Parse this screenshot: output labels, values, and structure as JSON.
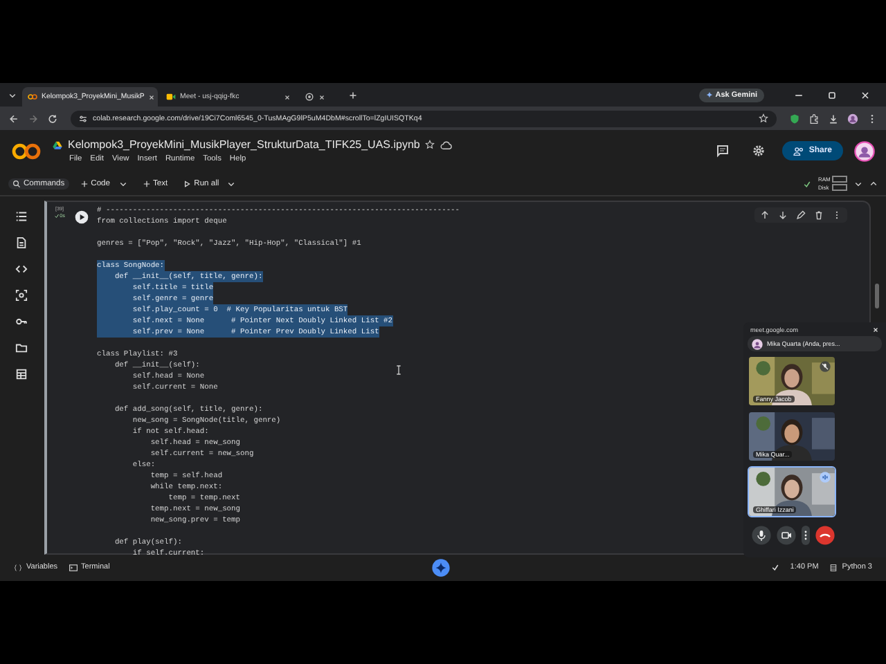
{
  "browser": {
    "tabs": [
      {
        "label": "Kelompok3_ProyekMini_MusikP",
        "selected": true
      },
      {
        "label": "Meet - usj-qqig-fkc",
        "selected": false
      },
      {
        "selected": false
      }
    ],
    "gemini_button": "Ask Gemini",
    "address": "colab.research.google.com/drive/19Ci7Coml6545_0-TusMAgG9lP5uM4DbM#scrollTo=lZgIUISQTKq4"
  },
  "notebook": {
    "title": "Kelompok3_ProyekMini_MusikPlayer_StrukturData_TIFK25_UAS.ipynb",
    "menu": [
      "File",
      "Edit",
      "View",
      "Insert",
      "Runtime",
      "Tools",
      "Help"
    ],
    "share_button": "Share",
    "toolbar": [
      "Commands",
      "Code",
      "Text",
      "Run all"
    ],
    "resources": [
      "RAM",
      "Disk"
    ]
  },
  "cell": {
    "execution_count": "[39]",
    "run_time": "0s",
    "blocks": [
      [
        {
          "text": "# -------------------------------------------------------------------------------",
          "selected": false
        },
        {
          "text": "from collections import deque",
          "selected": false
        }
      ],
      [
        {
          "text": "genres = [\"Pop\", \"Rock\", \"Jazz\", \"Hip-Hop\", \"Classical\"] #1",
          "selected": false
        }
      ],
      [
        {
          "text": "class SongNode:",
          "selected": true
        },
        {
          "text": "    def __init__(self, title, genre):",
          "selected": true
        },
        {
          "text": "        self.title = title",
          "selected": true
        },
        {
          "text": "        self.genre = genre",
          "selected": true
        },
        {
          "text": "        self.play_count = 0  # Key Popularitas untuk BST",
          "selected": true
        },
        {
          "text": "        self.next = None      # Pointer Next Doubly Linked List #2",
          "selected": true
        },
        {
          "text": "        self.prev = None      # Pointer Prev Doubly Linked List",
          "selected": true
        }
      ],
      [
        {
          "text": "class Playlist: #3",
          "selected": false
        },
        {
          "text": "    def __init__(self):",
          "selected": false
        },
        {
          "text": "        self.head = None",
          "selected": false
        },
        {
          "text": "        self.current = None",
          "selected": false
        }
      ],
      [
        {
          "text": "    def add_song(self, title, genre):",
          "selected": false
        },
        {
          "text": "        new_song = SongNode(title, genre)",
          "selected": false
        },
        {
          "text": "        if not self.head:",
          "selected": false
        },
        {
          "text": "            self.head = new_song",
          "selected": false
        },
        {
          "text": "            self.current = new_song",
          "selected": false
        },
        {
          "text": "        else:",
          "selected": false
        },
        {
          "text": "            temp = self.head",
          "selected": false
        },
        {
          "text": "            while temp.next:",
          "selected": false
        },
        {
          "text": "                temp = temp.next",
          "selected": false
        },
        {
          "text": "            temp.next = new_song",
          "selected": false
        },
        {
          "text": "            new_song.prev = temp",
          "selected": false
        }
      ],
      [
        {
          "text": "    def play(self):",
          "selected": false
        },
        {
          "text": "        if self.current:",
          "selected": false
        }
      ]
    ]
  },
  "status_bar": {
    "items": [
      "Variables",
      "Terminal"
    ],
    "time": "1:40 PM",
    "runtime": "Python 3"
  },
  "meet": {
    "site": "meet.google.com",
    "presenter": "Mika Quarta (Anda, pres...",
    "participants": [
      {
        "name": "Fanny Jacob",
        "muted": true,
        "speaking": false
      },
      {
        "name": "Mika Quar...",
        "muted": false,
        "speaking": false
      },
      {
        "name": "Ghiffari Izzani",
        "muted": false,
        "speaking": true
      }
    ]
  }
}
